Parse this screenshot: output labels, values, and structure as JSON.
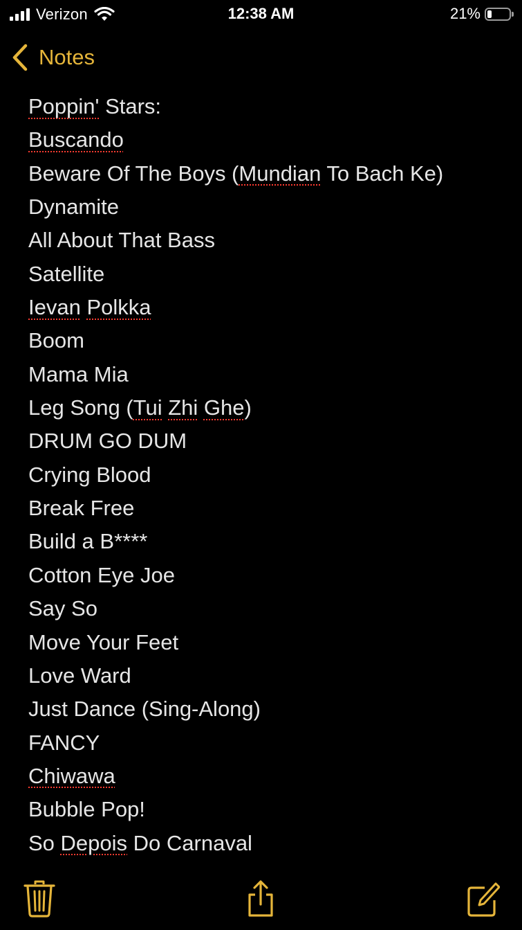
{
  "status_bar": {
    "carrier": "Verizon",
    "time": "12:38 AM",
    "battery_percent": "21%",
    "battery_level": 0.21,
    "icons": [
      "signal-bars-icon",
      "wifi-icon",
      "battery-icon"
    ]
  },
  "nav": {
    "back_label": "Notes",
    "accent_color": "#E5B53A",
    "back_icon": "chevron-left-icon"
  },
  "note": {
    "lines": [
      {
        "segments": [
          {
            "text": "Poppin'",
            "misspelled": true
          },
          {
            "text": " Stars:",
            "misspelled": false
          }
        ]
      },
      {
        "segments": [
          {
            "text": "Buscando",
            "misspelled": true
          }
        ]
      },
      {
        "segments": [
          {
            "text": "Beware Of The Boys (",
            "misspelled": false
          },
          {
            "text": "Mundian",
            "misspelled": true
          },
          {
            "text": " To Bach Ke)",
            "misspelled": false
          }
        ]
      },
      {
        "segments": [
          {
            "text": "Dynamite",
            "misspelled": false
          }
        ]
      },
      {
        "segments": [
          {
            "text": "All About That Bass",
            "misspelled": false
          }
        ]
      },
      {
        "segments": [
          {
            "text": "Satellite",
            "misspelled": false
          }
        ]
      },
      {
        "segments": [
          {
            "text": "Ievan",
            "misspelled": true
          },
          {
            "text": " ",
            "misspelled": false
          },
          {
            "text": "Polkka",
            "misspelled": true
          }
        ]
      },
      {
        "segments": [
          {
            "text": "Boom",
            "misspelled": false
          }
        ]
      },
      {
        "segments": [
          {
            "text": "Mama Mia",
            "misspelled": false
          }
        ]
      },
      {
        "segments": [
          {
            "text": "Leg Song (",
            "misspelled": false
          },
          {
            "text": "Tui",
            "misspelled": true
          },
          {
            "text": " ",
            "misspelled": false
          },
          {
            "text": "Zhi",
            "misspelled": true
          },
          {
            "text": " ",
            "misspelled": false
          },
          {
            "text": "Ghe",
            "misspelled": true
          },
          {
            "text": ")",
            "misspelled": false
          }
        ]
      },
      {
        "segments": [
          {
            "text": "DRUM GO DUM",
            "misspelled": false
          }
        ]
      },
      {
        "segments": [
          {
            "text": "Crying Blood",
            "misspelled": false
          }
        ]
      },
      {
        "segments": [
          {
            "text": "Break Free",
            "misspelled": false
          }
        ]
      },
      {
        "segments": [
          {
            "text": "Build a B****",
            "misspelled": false
          }
        ]
      },
      {
        "segments": [
          {
            "text": "Cotton Eye Joe",
            "misspelled": false
          }
        ]
      },
      {
        "segments": [
          {
            "text": "Say So",
            "misspelled": false
          }
        ]
      },
      {
        "segments": [
          {
            "text": "Move Your Feet",
            "misspelled": false
          }
        ]
      },
      {
        "segments": [
          {
            "text": "Love Ward",
            "misspelled": false
          }
        ]
      },
      {
        "segments": [
          {
            "text": "Just Dance (Sing-Along)",
            "misspelled": false
          }
        ]
      },
      {
        "segments": [
          {
            "text": "FANCY",
            "misspelled": false
          }
        ]
      },
      {
        "segments": [
          {
            "text": "Chiwawa",
            "misspelled": true
          }
        ]
      },
      {
        "segments": [
          {
            "text": "Bubble Pop!",
            "misspelled": false
          }
        ]
      },
      {
        "segments": [
          {
            "text": "So ",
            "misspelled": false
          },
          {
            "text": "Depois",
            "misspelled": true
          },
          {
            "text": " Do Carnaval",
            "misspelled": false
          }
        ]
      }
    ]
  },
  "toolbar": {
    "buttons": [
      "trash-icon",
      "share-icon",
      "compose-icon"
    ]
  },
  "colors": {
    "background": "#000000",
    "text": "#e6e6e6",
    "accent": "#E5B53A",
    "spellcheck": "#ff3b30"
  }
}
